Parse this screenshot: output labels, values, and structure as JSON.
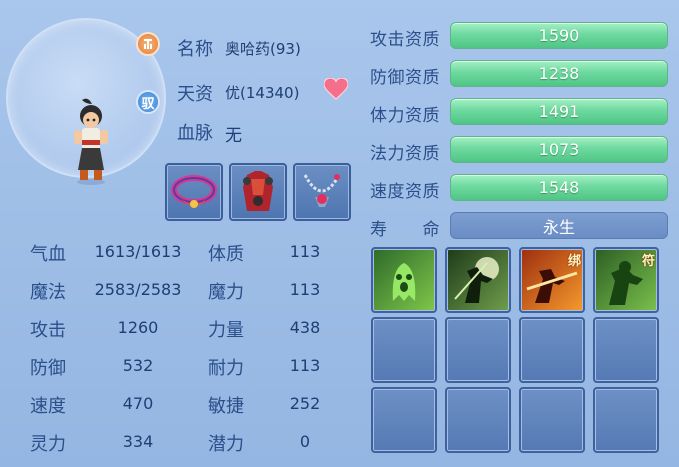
{
  "pet": {
    "name_label": "名称",
    "name_value": "奥哈药(93)",
    "aptitude_label": "天资",
    "aptitude_value": "优(14340)",
    "bloodline_label": "血脉",
    "bloodline_value": "无",
    "badge_top": "",
    "badge_mid": "驭"
  },
  "items": [
    {
      "name": "collar-item"
    },
    {
      "name": "armor-item"
    },
    {
      "name": "necklace-item"
    }
  ],
  "stats": {
    "qixue_label": "气血",
    "qixue_value": "1613/1613",
    "tizhi_label": "体质",
    "tizhi_value": "113",
    "mofa_label": "魔法",
    "mofa_value": "2583/2583",
    "moli_label": "魔力",
    "moli_value": "113",
    "gongji_label": "攻击",
    "gongji_value": "1260",
    "liliang_label": "力量",
    "liliang_value": "438",
    "fangyu_label": "防御",
    "fangyu_value": "532",
    "naili_label": "耐力",
    "naili_value": "113",
    "sudu_label": "速度",
    "sudu_value": "470",
    "minjie_label": "敏捷",
    "minjie_value": "252",
    "lingli_label": "灵力",
    "lingli_value": "334",
    "qianli_label": "潜力",
    "qianli_value": "0"
  },
  "aptitudes": {
    "attack_label": "攻击资质",
    "attack_value": "1590",
    "defense_label": "防御资质",
    "defense_value": "1238",
    "stamina_label": "体力资质",
    "stamina_value": "1491",
    "magic_label": "法力资质",
    "magic_value": "1073",
    "speed_label": "速度资质",
    "speed_value": "1548",
    "life_label": "寿　　命",
    "life_value": "永生"
  },
  "skills": {
    "skill3_tag": "绑",
    "skill4_tag": "符"
  },
  "colors": {
    "bar_green": "#6ed99f",
    "background": "#9dbde6",
    "text": "#2b4f8a"
  }
}
